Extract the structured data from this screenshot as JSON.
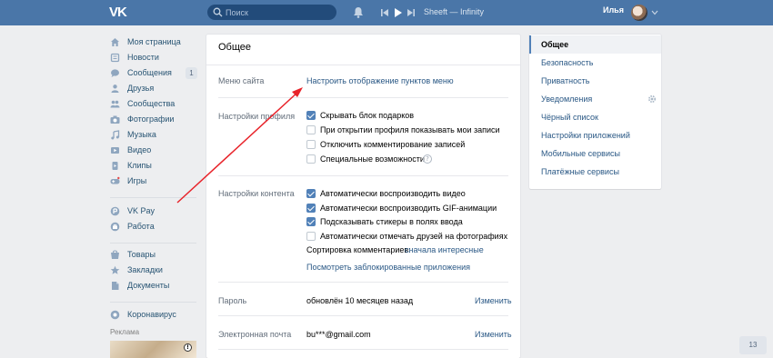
{
  "header": {
    "logo_text": "VK",
    "search_placeholder": "Поиск",
    "player_track": "Sheeft — Infinity",
    "user_name": "Илья"
  },
  "sidebar": {
    "items": [
      {
        "label": "Моя страница",
        "icon": "home-icon"
      },
      {
        "label": "Новости",
        "icon": "news-icon"
      },
      {
        "label": "Сообщения",
        "icon": "messages-icon",
        "badge": "1"
      },
      {
        "label": "Друзья",
        "icon": "friends-icon"
      },
      {
        "label": "Сообщества",
        "icon": "groups-icon"
      },
      {
        "label": "Фотографии",
        "icon": "camera-icon"
      },
      {
        "label": "Музыка",
        "icon": "music-icon"
      },
      {
        "label": "Видео",
        "icon": "video-icon"
      },
      {
        "label": "Клипы",
        "icon": "clips-icon"
      },
      {
        "label": "Игры",
        "icon": "games-icon"
      },
      {
        "label": "VK Pay",
        "icon": "vkpay-icon"
      },
      {
        "label": "Работа",
        "icon": "work-icon"
      },
      {
        "label": "Товары",
        "icon": "shop-icon"
      },
      {
        "label": "Закладки",
        "icon": "star-icon"
      },
      {
        "label": "Документы",
        "icon": "document-icon"
      },
      {
        "label": "Коронавирус",
        "icon": "virus-icon"
      }
    ],
    "ads_title": "Реклама"
  },
  "settings": {
    "title": "Общее",
    "site_menu": {
      "label": "Меню сайта",
      "link": "Настроить отображение пунктов меню"
    },
    "profile": {
      "label": "Настройки профиля",
      "options": [
        {
          "text": "Скрывать блок подарков",
          "checked": true
        },
        {
          "text": "При открытии профиля показывать мои записи",
          "checked": false
        },
        {
          "text": "Отключить комментирование записей",
          "checked": false
        },
        {
          "text": "Специальные возможности",
          "checked": false
        }
      ]
    },
    "content": {
      "label": "Настройки контента",
      "options": [
        {
          "text": "Автоматически воспроизводить видео",
          "checked": true
        },
        {
          "text": "Автоматически воспроизводить GIF-анимации",
          "checked": true
        },
        {
          "text": "Подсказывать стикеры в полях ввода",
          "checked": true
        },
        {
          "text": "Автоматически отмечать друзей на фотографиях",
          "checked": false
        }
      ],
      "sort_label": "Сортировка комментариев:",
      "sort_value": "сначала интересные",
      "blocked_apps_link": "Посмотреть заблокированные приложения"
    },
    "password": {
      "label": "Пароль",
      "value": "обновлён 10 месяцев назад",
      "action": "Изменить"
    },
    "email": {
      "label": "Электронная почта",
      "value": "bu***@gmail.com",
      "action": "Изменить"
    }
  },
  "right_menu": {
    "items": [
      {
        "label": "Общее",
        "active": true
      },
      {
        "label": "Безопасность",
        "active": false
      },
      {
        "label": "Приватность",
        "active": false
      },
      {
        "label": "Уведомления",
        "active": false
      },
      {
        "label": "Чёрный список",
        "active": false
      },
      {
        "label": "Настройки приложений",
        "active": false
      },
      {
        "label": "Мобильные сервисы",
        "active": false
      },
      {
        "label": "Платёжные сервисы",
        "active": false
      }
    ]
  },
  "chat_counter": "13",
  "colors": {
    "header": "#4a76a8",
    "link": "#2a5885",
    "checkbox_on": "#5181b8",
    "annotation_arrow": "#e8232a"
  }
}
